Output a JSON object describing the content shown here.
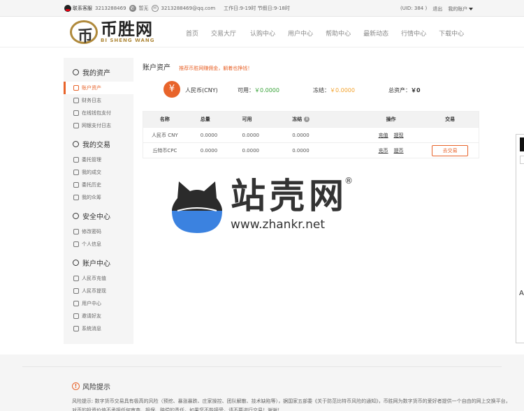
{
  "topbar": {
    "qq_label": "联系客服",
    "phone": "3213288469",
    "phone_status": "暂无",
    "email": "3213288469@qq.com",
    "hours": "工作日:9-19时 节假日:9-18时",
    "uid": "(UID: 384 )",
    "logout": "退出",
    "my_account": "我的账户"
  },
  "header": {
    "logo_cn": "币胜网",
    "logo_en": "BI SHENG WANG",
    "nav": [
      "首页",
      "交易大厅",
      "认购中心",
      "用户中心",
      "帮助中心",
      "最新动态",
      "行情中心",
      "下载中心"
    ]
  },
  "sidebar": {
    "groups": [
      {
        "title": "我的资产",
        "items": [
          "账户资产",
          "财务日志",
          "在线钱包支付",
          "网银支付日志"
        ]
      },
      {
        "title": "我的交易",
        "items": [
          "委托管理",
          "我的成交",
          "委托历史",
          "我的众筹"
        ]
      },
      {
        "title": "安全中心",
        "items": [
          "修改密码",
          "个人信息"
        ]
      },
      {
        "title": "账户中心",
        "items": [
          "人民币充值",
          "人民币提现",
          "用户中心",
          "邀请好友",
          "系统消息"
        ]
      }
    ]
  },
  "main": {
    "title": "账户资产",
    "tip": "推荐币胜网赚佣金，躺着也挣钱！",
    "asset": {
      "currency": "人民币(CNY)",
      "available_label": "可用：",
      "available_value": "￥0.0000",
      "frozen_label": "冻结：",
      "frozen_value": "￥0.0000",
      "total_label": "总资产：",
      "total_value": "￥0"
    },
    "table": {
      "headers": [
        "名称",
        "总量",
        "可用",
        "冻结",
        "操作",
        "交易"
      ],
      "rows": [
        {
          "name": "人民币 CNY",
          "total": "0.0000",
          "available": "0.0000",
          "frozen": "0.0000",
          "op1": "充值",
          "op2": "提现",
          "trade": ""
        },
        {
          "name": "丘特币CPC",
          "total": "0.0000",
          "available": "0.0000",
          "frozen": "0.0000",
          "op1": "充币",
          "op2": "提币",
          "trade": "去交易"
        }
      ]
    }
  },
  "watermark": {
    "cn": "站壳网",
    "reg": "®",
    "url": "www.zhankr.net"
  },
  "edge": {
    "letter": "A"
  },
  "footer": {
    "risk_title": "风险提示",
    "risk_text": "风险提示: 数字货币交易具有极高的风险（预挖、暴涨暴跌、庄家操控、团队解散、技术缺陷等），据国家五部委《关于防范比特币风险的通知》，币胜网为数字货币的爱好者提供一个自由的网上交换平台，对币的投资价值不承担任何审查、担保、赔偿的责任，如果您不能接受，请不要进行交易！谢谢！"
  },
  "colors": {
    "accent": "#e8642b",
    "gold": "#b08a3c",
    "green": "#3aa33a",
    "orange": "#f3a32e",
    "watermark_blue": "#3b82e0"
  }
}
